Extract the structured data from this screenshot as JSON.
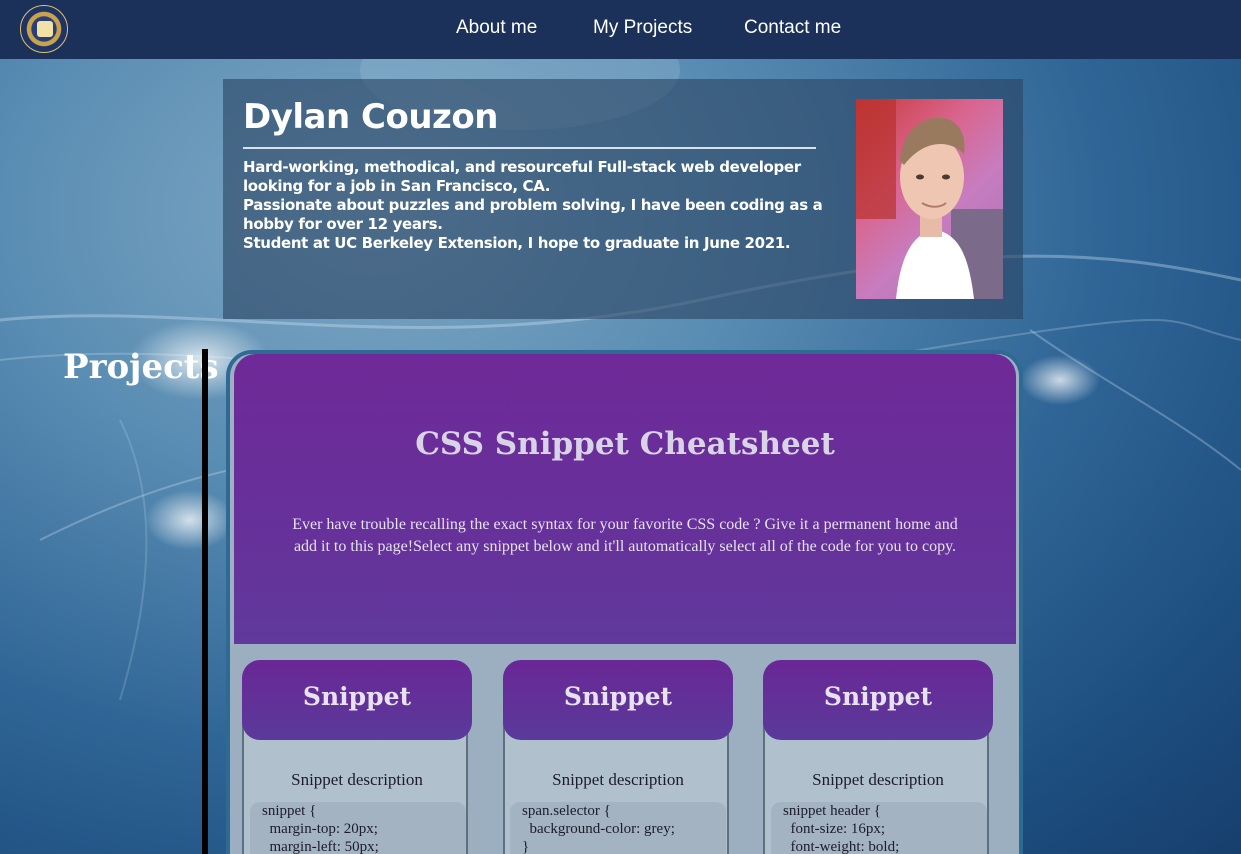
{
  "nav": {
    "links": [
      "About me",
      "My Projects",
      "Contact me"
    ]
  },
  "header": {
    "name": "Dylan Couzon",
    "bio": [
      "Hard-working, methodical, and resourceful Full-stack web developer looking for a job in San Francisco, CA.",
      "Passionate about puzzles and problem solving, I have been coding as a hobby for over 12 years.",
      "Student at UC Berkeley Extension, I hope to graduate in June 2021."
    ]
  },
  "projects": {
    "title": "Projects",
    "preview": {
      "title": "CSS Snippet Cheatsheet",
      "description": "Ever have trouble recalling the exact syntax for your favorite CSS code ? Give it a permanent home and add it to this page!Select any snippet below and it'll automatically select all of the code for you to copy.",
      "snippets": [
        {
          "title": "Snippet",
          "description": "Snippet description",
          "code": "snippet {\n  margin-top: 20px;\n  margin-left: 50px;"
        },
        {
          "title": "Snippet",
          "description": "Snippet description",
          "code": "span.selector {\n  background-color: grey;\n}"
        },
        {
          "title": "Snippet",
          "description": "Snippet description",
          "code": "snippet header {\n  font-size: 16px;\n  font-weight: bold;"
        }
      ]
    }
  },
  "colors": {
    "navbar": "#1b315a",
    "card_purple": "#6e2a98",
    "card_border": "#2e6a94"
  }
}
